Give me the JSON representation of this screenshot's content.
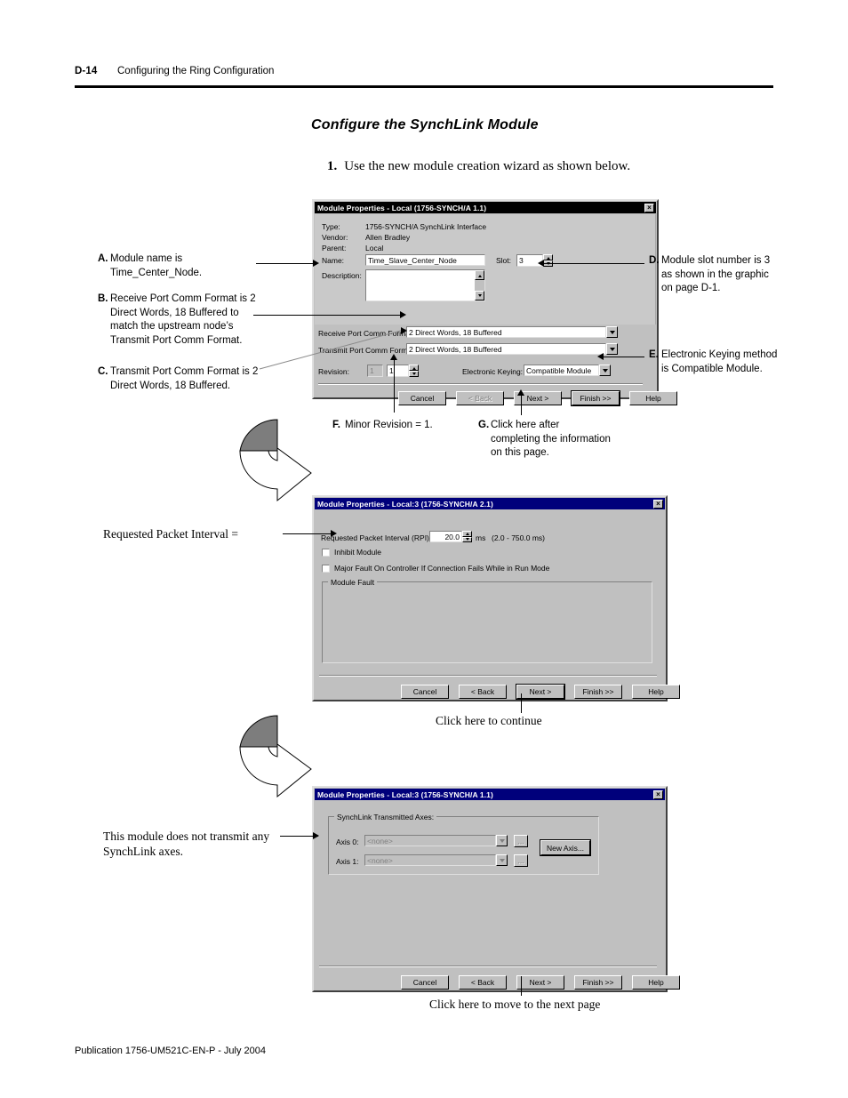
{
  "page": {
    "folio": "D-14",
    "chapter": "Configuring the Ring Configuration",
    "section_title": "Configure the SynchLink Module",
    "step_number": "1.",
    "step_text": "Use the new module creation wizard as shown below.",
    "footer": "Publication 1756-UM521C-EN-P - July 2004"
  },
  "dialog1": {
    "title": "Module Properties - Local (1756-SYNCH/A 1.1)",
    "close_label": "×",
    "labels": {
      "type": "Type:",
      "vendor": "Vendor:",
      "parent": "Parent:",
      "name": "Name:",
      "description": "Description:",
      "slot": "Slot:",
      "receive_format": "Receive Port Comm Format:",
      "transmit_format": "Transmit Port Comm Format:",
      "revision": "Revision:",
      "keying": "Electronic Keying:"
    },
    "values": {
      "type": "1756-SYNCH/A SynchLink Interface",
      "vendor": "Allen Bradley",
      "parent": "Local",
      "name": "Time_Slave_Center_Node",
      "description": "",
      "slot": "3",
      "receive_format": "2 Direct Words, 18 Buffered",
      "transmit_format": "2 Direct Words, 18 Buffered",
      "revision_major": "1",
      "revision_minor": "1",
      "keying": "Compatible Module"
    },
    "buttons": {
      "cancel": "Cancel",
      "back": "< Back",
      "next": "Next >",
      "finish": "Finish >>",
      "help": "Help"
    }
  },
  "dialog2": {
    "title": "Module Properties - Local:3 (1756-SYNCH/A 2.1)",
    "close_label": "×",
    "rpi_label": "Requested Packet Interval (RPI):",
    "rpi_value": "20.0",
    "rpi_unit": "ms",
    "rpi_range": "(2.0 - 750.0 ms)",
    "inhibit_label": "Inhibit Module",
    "major_fault_label": "Major Fault On Controller If Connection Fails While in Run Mode",
    "module_fault_legend": "Module Fault",
    "buttons": {
      "cancel": "Cancel",
      "back": "< Back",
      "next": "Next >",
      "finish": "Finish >>",
      "help": "Help"
    }
  },
  "dialog3": {
    "title": "Module Properties - Local:3 (1756-SYNCH/A 1.1)",
    "close_label": "×",
    "group_legend": "SynchLink Transmitted Axes:",
    "axis0_label": "Axis 0:",
    "axis0_value": "<none>",
    "axis1_label": "Axis 1:",
    "axis1_value": "<none>",
    "browse_label": "...",
    "new_axis_label": "New Axis...",
    "buttons": {
      "cancel": "Cancel",
      "back": "< Back",
      "next": "Next >",
      "finish": "Finish >>",
      "help": "Help"
    }
  },
  "annotations": {
    "a": {
      "letter": "A.",
      "text": "Module name is Time_Center_Node."
    },
    "b": {
      "letter": "B.",
      "text": "Receive Port Comm Format is 2 Direct Words, 18 Buffered to match the upstream node’s Transmit Port Comm Format."
    },
    "c": {
      "letter": "C.",
      "text": "Transmit Port Comm Format is 2 Direct Words, 18 Buffered."
    },
    "d": {
      "letter": "D.",
      "text": "Module slot number is 3 as shown in the graphic on page D-1."
    },
    "e": {
      "letter": "E.",
      "text": "Electronic Keying method is Compatible Module."
    },
    "f": {
      "letter": "F.",
      "text": "Minor Revision = 1."
    },
    "g": {
      "letter": "G.",
      "text": "Click here after completing the information on this page."
    },
    "rpi": "Requested Packet Interval =",
    "no_axes": "This module does not transmit any SynchLink axes.",
    "continue": "Click here to continue",
    "next_page": "Click here to move to the next page"
  }
}
